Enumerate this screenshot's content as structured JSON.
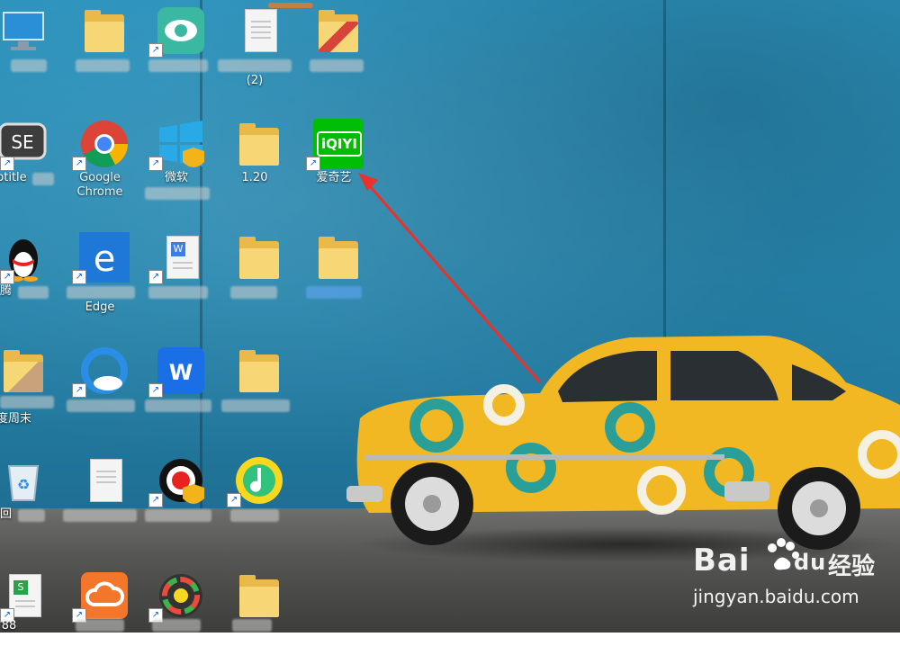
{
  "desktop": {
    "icons": [
      {
        "id": "this-pc",
        "label": "我"
      },
      {
        "id": "folder-1",
        "label": ""
      },
      {
        "id": "green-eye-app",
        "label": ""
      },
      {
        "id": "text-doc-2",
        "label": "(2)"
      },
      {
        "id": "folder-colorful",
        "label": ""
      },
      {
        "id": "subtitle-edit",
        "label": "btitle"
      },
      {
        "id": "google-chrome",
        "label": "Google Chrome"
      },
      {
        "id": "microsoft-windows",
        "label": "微软"
      },
      {
        "id": "folder-1-20",
        "label": "1.20"
      },
      {
        "id": "iqiyi",
        "label": "爱奇艺"
      },
      {
        "id": "tencent-qq",
        "label": "腾"
      },
      {
        "id": "microsoft-edge",
        "label": "Edge"
      },
      {
        "id": "wps-writer-doc",
        "label": ""
      },
      {
        "id": "folder-3",
        "label": ""
      },
      {
        "id": "folder-selected",
        "label": ""
      },
      {
        "id": "folder-baidu",
        "label": "度周末"
      },
      {
        "id": "qq-browser",
        "label": ""
      },
      {
        "id": "wps-office",
        "label": ""
      },
      {
        "id": "folder-4",
        "label": ""
      },
      {
        "id": "recycle-bin",
        "label": "回"
      },
      {
        "id": "new-text-doc",
        "label": ""
      },
      {
        "id": "video-app",
        "label": ""
      },
      {
        "id": "qq-music",
        "label": ""
      },
      {
        "id": "wps-sheet",
        "label": "88"
      },
      {
        "id": "cloud-app",
        "label": ""
      },
      {
        "id": "color-wheel-app",
        "label": ""
      },
      {
        "id": "folder-5",
        "label": ""
      }
    ]
  },
  "watermark": {
    "brand": "Bai",
    "brand_suffix": "du",
    "cn": "经验",
    "url": "jingyan.baidu.com"
  },
  "iqiyi_logo_text": "iQIYI",
  "colors": {
    "wall": "#2686ae",
    "car_yellow": "#f2b823",
    "car_teal": "#2a9f9a",
    "arrow_red": "#e8332a",
    "iqiyi_green": "#00be06"
  }
}
